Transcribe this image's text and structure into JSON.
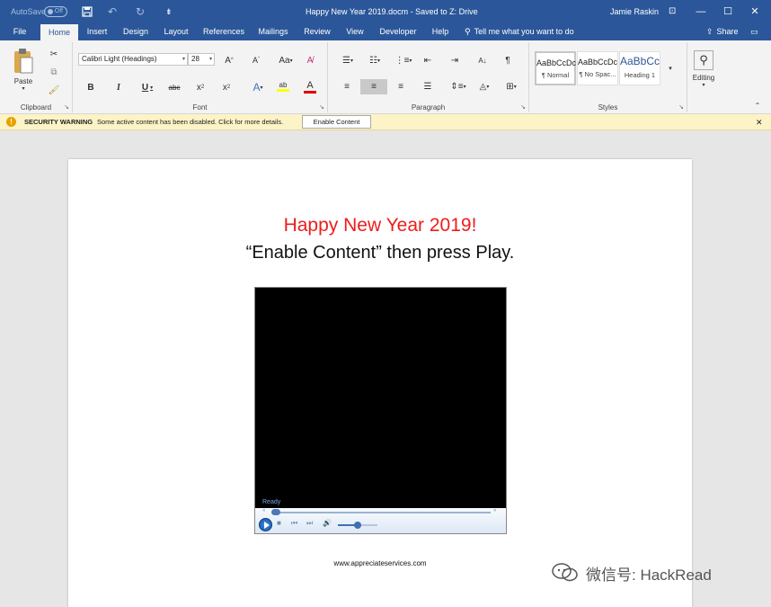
{
  "titlebar": {
    "autosave_label": "AutoSave",
    "autosave_state": "Off",
    "title": "Happy New Year 2019.docm - Saved to Z: Drive",
    "user": "Jamie Raskin"
  },
  "tabs": [
    {
      "label": "File"
    },
    {
      "label": "Home"
    },
    {
      "label": "Insert"
    },
    {
      "label": "Design"
    },
    {
      "label": "Layout"
    },
    {
      "label": "References"
    },
    {
      "label": "Mailings"
    },
    {
      "label": "Review"
    },
    {
      "label": "View"
    },
    {
      "label": "Developer"
    },
    {
      "label": "Help"
    }
  ],
  "tellme": "Tell me what you want to do",
  "share": "Share",
  "ribbon": {
    "clipboard": {
      "label": "Clipboard",
      "paste": "Paste"
    },
    "font": {
      "label": "Font",
      "family": "Calibri Light (Headings)",
      "size": "28"
    },
    "paragraph": {
      "label": "Paragraph"
    },
    "styles": {
      "label": "Styles",
      "items": [
        {
          "preview": "AaBbCcDc",
          "name": "¶ Normal"
        },
        {
          "preview": "AaBbCcDc",
          "name": "¶ No Spac..."
        },
        {
          "preview": "AaBbCc",
          "name": "Heading 1"
        }
      ]
    },
    "editing": {
      "label": "Editing"
    }
  },
  "warning": {
    "title": "SECURITY WARNING",
    "message": "Some active content has been disabled. Click for more details.",
    "button": "Enable Content"
  },
  "document": {
    "title": "Happy New Year 2019!",
    "subtitle": "“Enable Content” then press Play.",
    "player_status": "Ready",
    "url": "www.appreciateservices.com"
  },
  "watermark": "微信号: HackRead"
}
